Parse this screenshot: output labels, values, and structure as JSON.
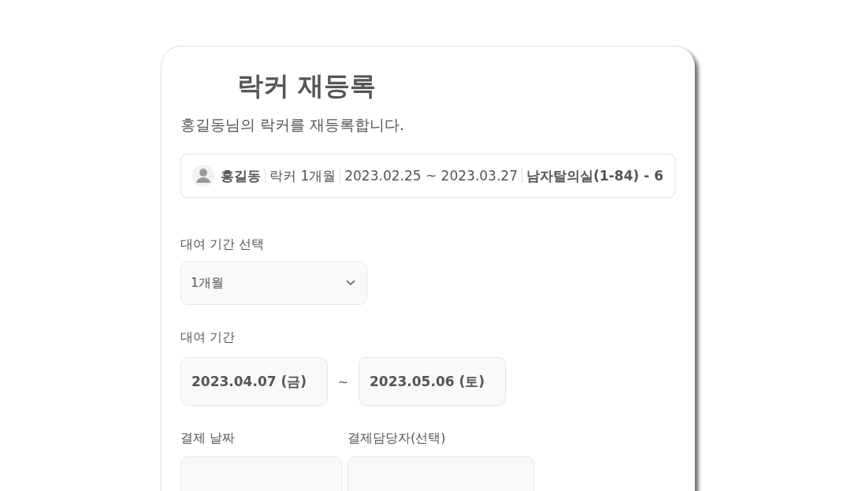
{
  "title": "락커 재등록",
  "subtitle": "홍길동님의 락커를 재등록합니다.",
  "member": {
    "segments": [
      {
        "text": "홍길동",
        "bold": true
      },
      {
        "text": "락커 1개월",
        "bold": false
      },
      {
        "text": "2023.02.25 ~ 2023.03.27",
        "bold": false
      },
      {
        "text": "남자탈의실(1-84) - 6",
        "bold": true
      }
    ]
  },
  "period_select": {
    "label": "대여 기간 선택",
    "value": "1개월"
  },
  "period": {
    "label": "대여 기간",
    "start": "2023.04.07 (금)",
    "separator": "~",
    "end": "2023.05.06 (토)"
  },
  "payment": {
    "date_label": "결제 날짜",
    "staff_label": "결제담당자(선택)"
  }
}
